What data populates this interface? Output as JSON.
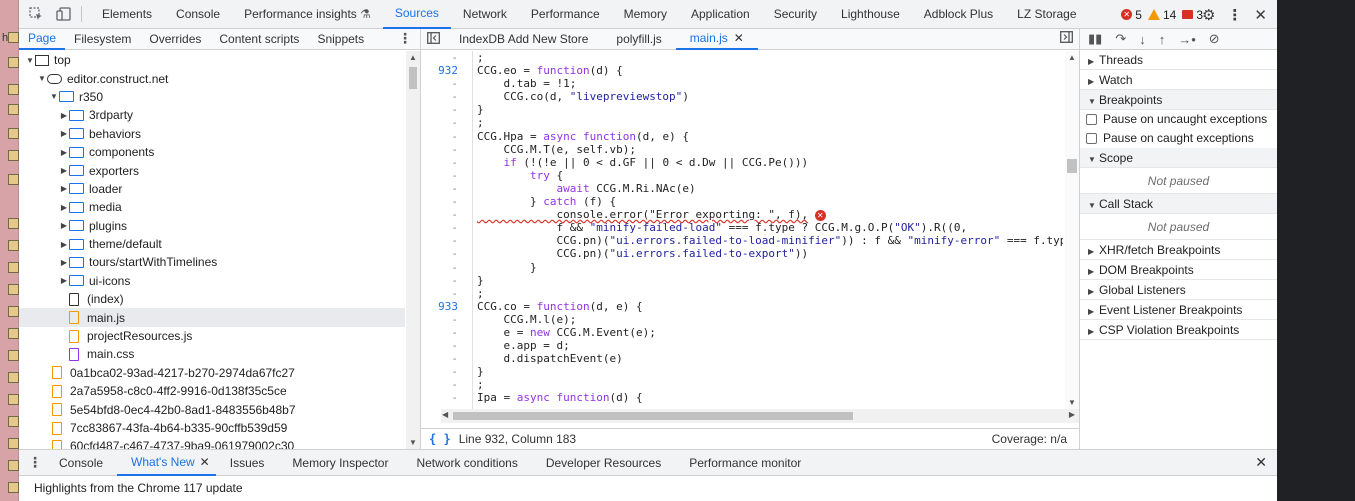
{
  "main_toolbar": {
    "tabs": [
      "Elements",
      "Console",
      "Performance insights",
      "Sources",
      "Network",
      "Performance",
      "Memory",
      "Application",
      "Security",
      "Lighthouse",
      "Adblock Plus",
      "LZ Storage"
    ],
    "active_tab": "Sources",
    "errors_count": "5",
    "warnings_count": "14",
    "issues_count": "3",
    "icons": [
      "inspect-element-icon",
      "device-toolbar-icon",
      "flask-icon",
      "settings-gear-icon",
      "more-vert-icon",
      "close-icon"
    ]
  },
  "navigator": {
    "tabs": [
      "Page",
      "Filesystem",
      "Overrides",
      "Content scripts",
      "Snippets"
    ],
    "active_tab": "Page",
    "tree": [
      {
        "label": "top",
        "depth": 0,
        "kind": "frame",
        "expanded": true
      },
      {
        "label": "editor.construct.net",
        "depth": 1,
        "kind": "cloud",
        "expanded": true
      },
      {
        "label": "r350",
        "depth": 2,
        "kind": "folder",
        "expanded": true
      },
      {
        "label": "3rdparty",
        "depth": 3,
        "kind": "folder",
        "expanded": false
      },
      {
        "label": "behaviors",
        "depth": 3,
        "kind": "folder",
        "expanded": false
      },
      {
        "label": "components",
        "depth": 3,
        "kind": "folder",
        "expanded": false
      },
      {
        "label": "exporters",
        "depth": 3,
        "kind": "folder",
        "expanded": false
      },
      {
        "label": "loader",
        "depth": 3,
        "kind": "folder",
        "expanded": false
      },
      {
        "label": "media",
        "depth": 3,
        "kind": "folder",
        "expanded": false
      },
      {
        "label": "plugins",
        "depth": 3,
        "kind": "folder",
        "expanded": false
      },
      {
        "label": "theme/default",
        "depth": 3,
        "kind": "folder",
        "expanded": false
      },
      {
        "label": "tours/startWithTimelines",
        "depth": 3,
        "kind": "folder",
        "expanded": false
      },
      {
        "label": "ui-icons",
        "depth": 3,
        "kind": "folder",
        "expanded": false
      },
      {
        "label": "(index)",
        "depth": 3,
        "kind": "file",
        "expanded": null
      },
      {
        "label": "main.js",
        "depth": 3,
        "kind": "js",
        "expanded": null,
        "selected": true
      },
      {
        "label": "projectResources.js",
        "depth": 3,
        "kind": "js",
        "expanded": null
      },
      {
        "label": "main.css",
        "depth": 3,
        "kind": "css",
        "expanded": null
      },
      {
        "label": "0a1bca02-93ad-4217-b270-2974da67fc27",
        "depth": 2,
        "kind": "doc",
        "expanded": null
      },
      {
        "label": "2a7a5958-c8c0-4ff2-9916-0d138f35c5ce",
        "depth": 2,
        "kind": "doc",
        "expanded": null
      },
      {
        "label": "5e54bfd8-0ec4-42b0-8ad1-8483556b48b7",
        "depth": 2,
        "kind": "doc",
        "expanded": null
      },
      {
        "label": "7cc83867-43fa-4b64-b335-90cffb539d59",
        "depth": 2,
        "kind": "doc",
        "expanded": null
      },
      {
        "label": "60cfd487-c467-4737-9ba9-061979002c30",
        "depth": 2,
        "kind": "doc",
        "expanded": null
      }
    ]
  },
  "editor": {
    "tabs": [
      {
        "label": "IndexDB Add New Store",
        "closable": false
      },
      {
        "label": "polyfill.js",
        "closable": false
      },
      {
        "label": "main.js",
        "closable": true,
        "active": true
      }
    ],
    "gutter": [
      "-",
      "932",
      "-",
      "-",
      "-",
      "-",
      "-",
      "-",
      "-",
      "-",
      "-",
      "-",
      "-",
      "-",
      "-",
      "-",
      "-",
      "-",
      "-",
      "933",
      "-",
      "-",
      "-",
      "-",
      "-",
      "-",
      "-"
    ],
    "lines": [
      ";",
      "CCG.eo = function(d) {",
      "    d.tab = !1;",
      "    CCG.co(d, \"livepreviewstop\")",
      "}",
      ";",
      "CCG.Hpa = async function(d, e) {",
      "    CCG.M.T(e, self.vb);",
      "    if (!(!e || 0 < d.GF || 0 < d.Dw || CCG.Pe()))",
      "        try {",
      "            await CCG.M.Ri.NAc(e)",
      "        } catch (f) {",
      "            console.error(\"Error exporting: \", f),",
      "            f && \"minify-failed-load\" === f.type ? CCG.M.g.O.P(\"OK\").R((0,",
      "            CCG.pn)(\"ui.errors.failed-to-load-minifier\")) : f && \"minify-error\" === f.type ? CCG.",
      "            CCG.pn)(\"ui.errors.failed-to-export\"))",
      "        }",
      "}",
      ";",
      "CCG.co = function(d, e) {",
      "    CCG.M.l(e);",
      "    e = new CCG.M.Event(e);",
      "    e.app = d;",
      "    d.dispatchEvent(e)",
      "}",
      ";",
      "Ipa = async function(d) {"
    ],
    "status_position": "Line 932, Column 183",
    "status_coverage": "Coverage: n/a"
  },
  "debugger": {
    "toolbar_icons": [
      "pause-icon",
      "step-over-icon",
      "step-into-icon",
      "step-out-icon",
      "step-icon",
      "deactivate-breakpoints-icon"
    ],
    "threads": "Threads",
    "watch": "Watch",
    "breakpoints": "Breakpoints",
    "pause_uncaught": "Pause on uncaught exceptions",
    "pause_caught": "Pause on caught exceptions",
    "scope": "Scope",
    "scope_state": "Not paused",
    "call_stack": "Call Stack",
    "call_stack_state": "Not paused",
    "collapsed_sections": [
      "XHR/fetch Breakpoints",
      "DOM Breakpoints",
      "Global Listeners",
      "Event Listener Breakpoints",
      "CSP Violation Breakpoints"
    ]
  },
  "drawer": {
    "tabs": [
      "Console",
      "What's New",
      "Issues",
      "Memory Inspector",
      "Network conditions",
      "Developer Resources",
      "Performance monitor"
    ],
    "active_tab": "What's New",
    "body": "Highlights from the Chrome 117 update"
  },
  "colors": {
    "accent": "#1a73e8",
    "error": "#d93025",
    "warning": "#f29900",
    "keyword": "#9334e6"
  }
}
